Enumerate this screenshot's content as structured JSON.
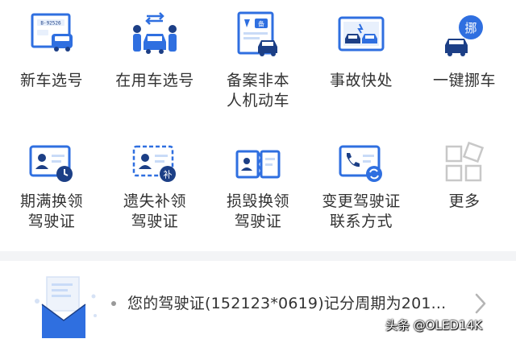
{
  "services": [
    {
      "label": "新车选号",
      "icon": "new-car-plate-icon"
    },
    {
      "label": "在用车选号",
      "icon": "used-car-plate-icon"
    },
    {
      "label": "备案非本\n人机动车",
      "icon": "register-vehicle-icon"
    },
    {
      "label": "事故快处",
      "icon": "accident-icon"
    },
    {
      "label": "一键挪车",
      "icon": "move-car-icon"
    },
    {
      "label": "期满换领\n驾驶证",
      "icon": "license-renew-icon"
    },
    {
      "label": "遗失补领\n驾驶证",
      "icon": "license-replace-icon"
    },
    {
      "label": "损毁换领\n驾驶证",
      "icon": "license-damaged-icon"
    },
    {
      "label": "变更驾驶证\n联系方式",
      "icon": "license-contact-icon"
    },
    {
      "label": "更多",
      "icon": "more-icon"
    }
  ],
  "icon_text": {
    "plate": "B·92526",
    "register": "备",
    "move": "挪",
    "supplement": "补"
  },
  "notice": {
    "text": "您的驾驶证(152123*0619)记分周期为201...",
    "icon": "mail-icon"
  },
  "watermark": "头条 @OLED14K",
  "colors": {
    "primary": "#2f6fe0",
    "dark": "#1c3f86",
    "light": "#e8f0fc",
    "gray": "#c8c8c8"
  }
}
